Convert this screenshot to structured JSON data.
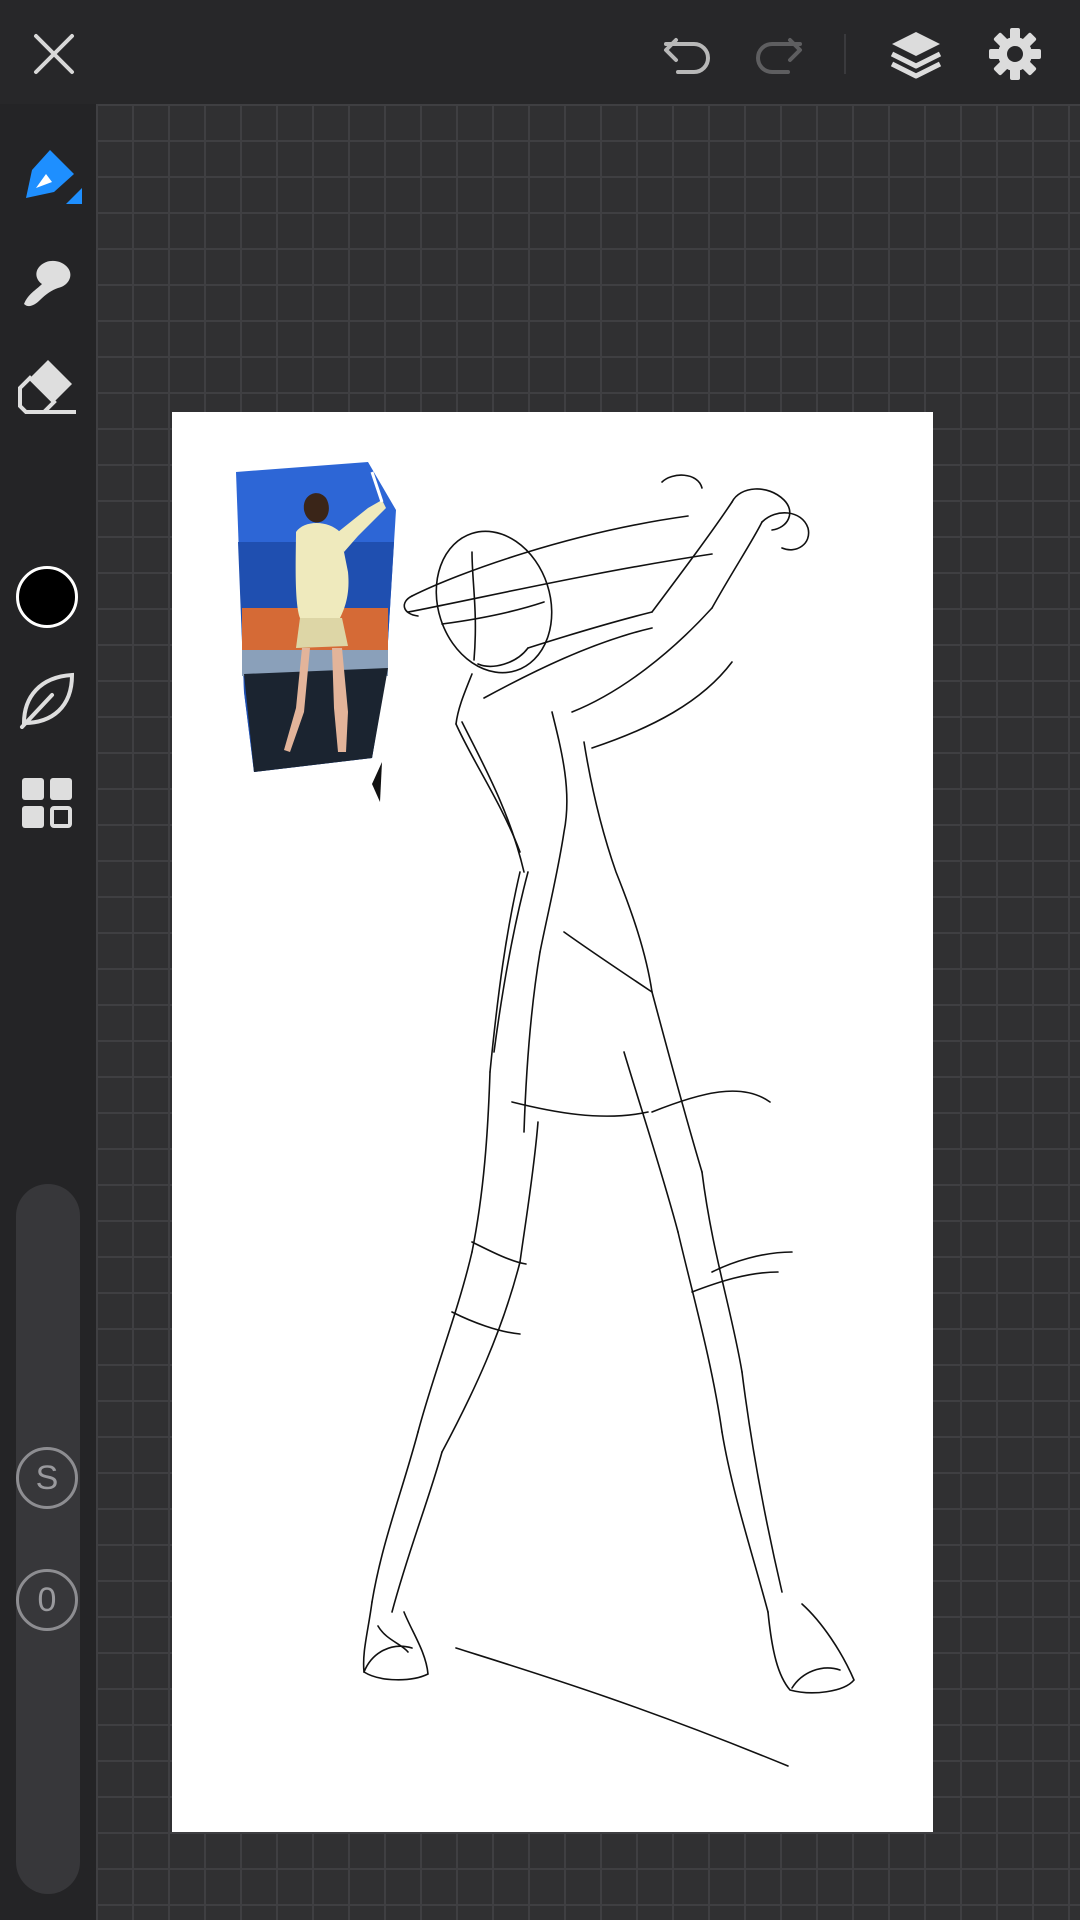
{
  "toolbar": {
    "close_icon": "close-icon",
    "undo_icon": "undo-icon",
    "redo_icon": "redo-icon",
    "layers_icon": "layers-icon",
    "settings_icon": "gear-icon"
  },
  "tools": {
    "active_tool": "pen",
    "items": [
      "pen-icon",
      "smudge-icon",
      "eraser-icon",
      "color-swatch",
      "leaf-icon",
      "panels-icon"
    ],
    "accent_color": "#1e8fff",
    "current_color": "#000000"
  },
  "sliders": {
    "s_label": "S",
    "o_label": "0"
  },
  "canvas": {
    "reference_photo": "golfer-reference-photo",
    "sketch": "gesture-sketch-golfer"
  }
}
